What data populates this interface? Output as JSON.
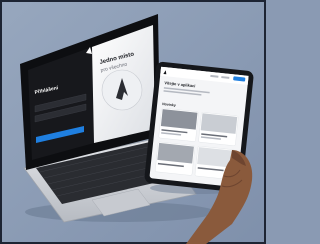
{
  "laptop": {
    "login_title": "Přihlášení",
    "headline_line1": "Jedno místo",
    "headline_line2": "pro všechno"
  },
  "tablet": {
    "hero_title": "Vítejte v aplikaci",
    "section_title": "Novinky"
  },
  "colors": {
    "background": "#8a9ab3",
    "accent": "#1f7fe0",
    "laptop_body": "#d6d8dc",
    "screen_dark": "#17181c"
  },
  "icons": [
    "logo-icon",
    "flame-icon"
  ]
}
